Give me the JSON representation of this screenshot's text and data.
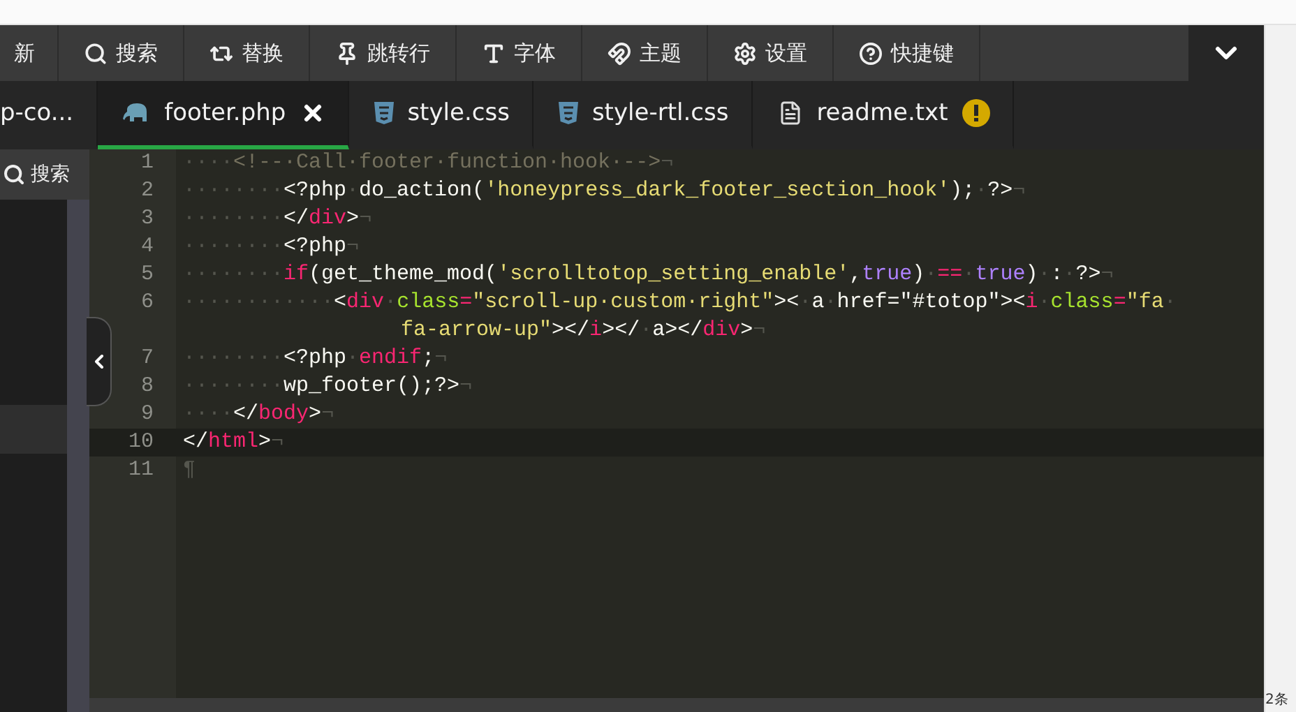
{
  "toolbar": {
    "items": [
      "新",
      "搜索",
      "替换",
      "跳转行",
      "字体",
      "主题",
      "设置",
      "快捷键"
    ]
  },
  "tabs": [
    {
      "label": "p-co...",
      "kind": "plain",
      "selected": false,
      "closable": false,
      "warning": false
    },
    {
      "label": "footer.php",
      "kind": "php",
      "selected": true,
      "closable": true,
      "warning": false
    },
    {
      "label": "style.css",
      "kind": "css",
      "selected": false,
      "closable": false,
      "warning": false
    },
    {
      "label": "style-rtl.css",
      "kind": "css",
      "selected": false,
      "closable": false,
      "warning": false
    },
    {
      "label": "readme.txt",
      "kind": "text",
      "selected": false,
      "closable": false,
      "warning": true
    }
  ],
  "sidebar": {
    "search_label": "搜索",
    "items": [
      {
        "selected": true
      }
    ]
  },
  "lines": [
    {
      "number": "1",
      "continuation": false,
      "highlighted": false,
      "tokens": [
        {
          "kind": "w",
          "text": "····"
        },
        {
          "kind": "c",
          "text": "<!--·Call·footer·function·hook·-->"
        },
        {
          "kind": "w",
          "text": "¬"
        }
      ]
    },
    {
      "number": "2",
      "continuation": false,
      "highlighted": false,
      "tokens": [
        {
          "kind": "w",
          "text": "········"
        },
        {
          "kind": "p",
          "text": "<?php"
        },
        {
          "kind": "w",
          "text": "·"
        },
        {
          "kind": "p",
          "text": "do_action("
        },
        {
          "kind": "s",
          "text": "'honeypress_dark_footer_section_hook'"
        },
        {
          "kind": "p",
          "text": ");"
        },
        {
          "kind": "w",
          "text": "·"
        },
        {
          "kind": "p",
          "text": "?>"
        },
        {
          "kind": "w",
          "text": "¬"
        }
      ]
    },
    {
      "number": "3",
      "continuation": false,
      "highlighted": false,
      "tokens": [
        {
          "kind": "w",
          "text": "········"
        },
        {
          "kind": "p",
          "text": "</"
        },
        {
          "kind": "t",
          "text": "div"
        },
        {
          "kind": "p",
          "text": ">"
        },
        {
          "kind": "w",
          "text": "¬"
        }
      ]
    },
    {
      "number": "4",
      "continuation": false,
      "highlighted": false,
      "tokens": [
        {
          "kind": "w",
          "text": "········"
        },
        {
          "kind": "p",
          "text": "<?php"
        },
        {
          "kind": "w",
          "text": "¬"
        }
      ]
    },
    {
      "number": "5",
      "continuation": false,
      "highlighted": false,
      "tokens": [
        {
          "kind": "w",
          "text": "········"
        },
        {
          "kind": "t",
          "text": "if"
        },
        {
          "kind": "p",
          "text": "(get_theme_mod("
        },
        {
          "kind": "s",
          "text": "'scrolltotop_setting_enable'"
        },
        {
          "kind": "p",
          "text": ","
        },
        {
          "kind": "k",
          "text": "true"
        },
        {
          "kind": "p",
          "text": ")"
        },
        {
          "kind": "w",
          "text": "·"
        },
        {
          "kind": "t",
          "text": "=="
        },
        {
          "kind": "w",
          "text": "·"
        },
        {
          "kind": "k",
          "text": "true"
        },
        {
          "kind": "p",
          "text": ")"
        },
        {
          "kind": "w",
          "text": "·"
        },
        {
          "kind": "p",
          "text": ":"
        },
        {
          "kind": "w",
          "text": "·"
        },
        {
          "kind": "p",
          "text": "?>"
        },
        {
          "kind": "w",
          "text": "¬"
        }
      ]
    },
    {
      "number": "6",
      "continuation": false,
      "highlighted": false,
      "tokens": [
        {
          "kind": "w",
          "text": "············"
        },
        {
          "kind": "p",
          "text": "<"
        },
        {
          "kind": "t",
          "text": "div"
        },
        {
          "kind": "w",
          "text": "·"
        },
        {
          "kind": "a",
          "text": "class"
        },
        {
          "kind": "t",
          "text": "="
        },
        {
          "kind": "s",
          "text": "\"scroll-up·custom·right\""
        },
        {
          "kind": "p",
          "text": "><"
        },
        {
          "kind": "w",
          "text": "·"
        },
        {
          "kind": "p",
          "text": "a"
        },
        {
          "kind": "w",
          "text": "·"
        },
        {
          "kind": "p",
          "text": "href=\"#totop\">"
        },
        {
          "kind": "p",
          "text": "<"
        },
        {
          "kind": "t",
          "text": "i"
        },
        {
          "kind": "w",
          "text": "·"
        },
        {
          "kind": "a",
          "text": "class"
        },
        {
          "kind": "t",
          "text": "="
        },
        {
          "kind": "s",
          "text": "\"fa"
        },
        {
          "kind": "w",
          "text": "·"
        }
      ]
    },
    {
      "continuation": true,
      "highlighted": false,
      "tokens": [
        {
          "kind": "s",
          "text": "fa-arrow-up\""
        },
        {
          "kind": "p",
          "text": "></"
        },
        {
          "kind": "t",
          "text": "i"
        },
        {
          "kind": "p",
          "text": "></"
        },
        {
          "kind": "w",
          "text": "·"
        },
        {
          "kind": "p",
          "text": "a></"
        },
        {
          "kind": "t",
          "text": "div"
        },
        {
          "kind": "p",
          "text": ">"
        },
        {
          "kind": "w",
          "text": "¬"
        }
      ]
    },
    {
      "number": "7",
      "continuation": false,
      "highlighted": false,
      "tokens": [
        {
          "kind": "w",
          "text": "········"
        },
        {
          "kind": "p",
          "text": "<?php"
        },
        {
          "kind": "w",
          "text": "·"
        },
        {
          "kind": "t",
          "text": "endif"
        },
        {
          "kind": "p",
          "text": ";"
        },
        {
          "kind": "w",
          "text": "¬"
        }
      ]
    },
    {
      "number": "8",
      "continuation": false,
      "highlighted": false,
      "tokens": [
        {
          "kind": "w",
          "text": "········"
        },
        {
          "kind": "p",
          "text": "wp_footer();?>"
        },
        {
          "kind": "w",
          "text": "¬"
        }
      ]
    },
    {
      "number": "9",
      "continuation": false,
      "highlighted": false,
      "tokens": [
        {
          "kind": "w",
          "text": "····"
        },
        {
          "kind": "p",
          "text": "</"
        },
        {
          "kind": "t",
          "text": "body"
        },
        {
          "kind": "p",
          "text": ">"
        },
        {
          "kind": "w",
          "text": "¬"
        }
      ]
    },
    {
      "number": "10",
      "continuation": false,
      "highlighted": true,
      "tokens": [
        {
          "kind": "p",
          "text": "</"
        },
        {
          "kind": "t",
          "text": "html"
        },
        {
          "kind": "p",
          "text": ">"
        },
        {
          "kind": "w",
          "text": "¬"
        }
      ]
    },
    {
      "number": "11",
      "continuation": false,
      "highlighted": false,
      "tokens": [
        {
          "kind": "w",
          "text": "¶"
        }
      ]
    }
  ],
  "right_panel": {
    "text": "2条"
  }
}
